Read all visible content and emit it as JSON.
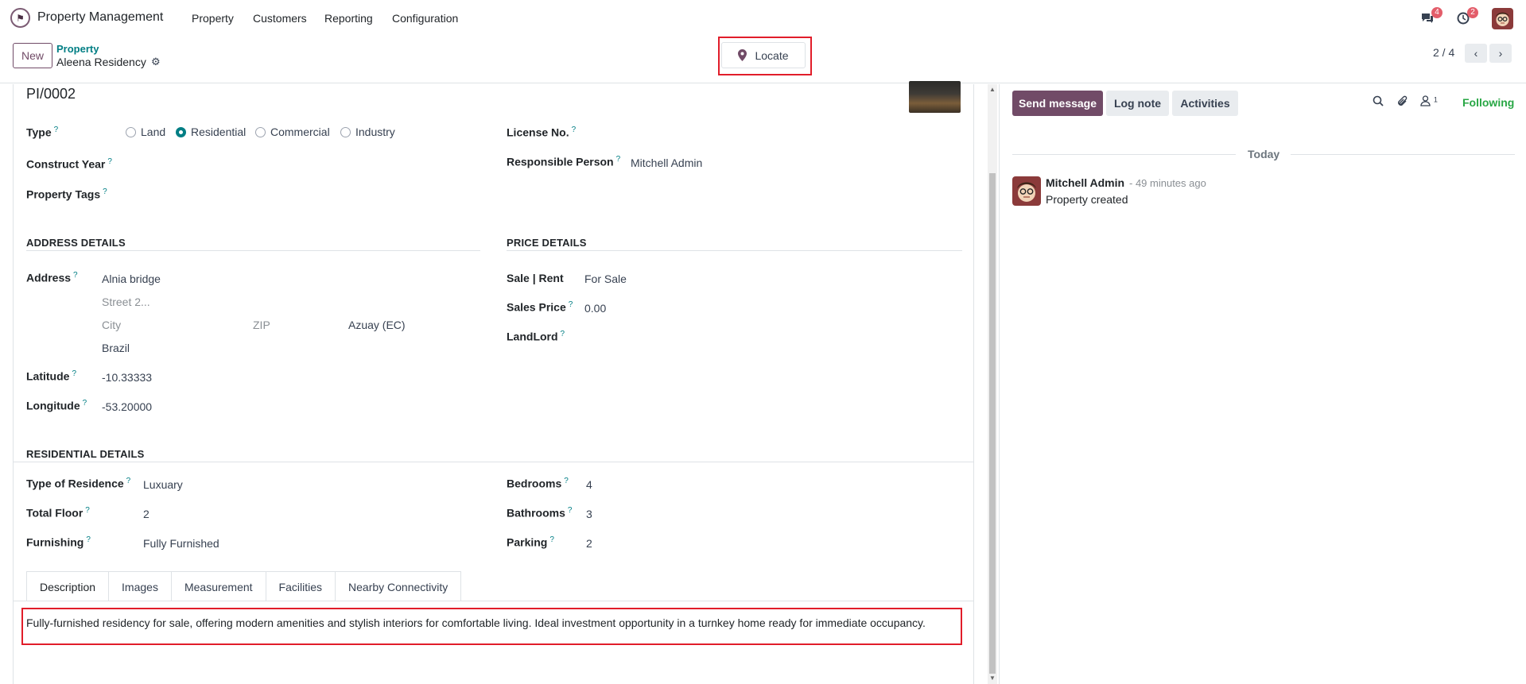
{
  "navbar": {
    "app_name": "Property Management",
    "menus": [
      "Property",
      "Customers",
      "Reporting",
      "Configuration"
    ],
    "messages_badge": "4",
    "activities_badge": "2"
  },
  "control": {
    "new_label": "New",
    "breadcrumb_parent": "Property",
    "breadcrumb_current": "Aleena Residency",
    "locate_label": "Locate",
    "pager": "2 / 4"
  },
  "form": {
    "reference": "PI/0002",
    "type_label": "Type",
    "type_options": [
      "Land",
      "Residential",
      "Commercial",
      "Industry"
    ],
    "type_selected": "Residential",
    "construct_year_label": "Construct Year",
    "property_tags_label": "Property Tags",
    "license_label": "License No.",
    "responsible_label": "Responsible Person",
    "responsible_value": "Mitchell Admin",
    "address_section": "ADDRESS DETAILS",
    "price_section": "PRICE DETAILS",
    "address_label": "Address",
    "street": "Alnia bridge",
    "street2_placeholder": "Street 2...",
    "city_placeholder": "City",
    "zip_placeholder": "ZIP",
    "state": "Azuay (EC)",
    "country": "Brazil",
    "latitude_label": "Latitude",
    "latitude": "-10.33333",
    "longitude_label": "Longitude",
    "longitude": "-53.20000",
    "sale_rent_label": "Sale | Rent",
    "sale_rent": "For Sale",
    "sales_price_label": "Sales Price",
    "sales_price": "0.00",
    "landlord_label": "LandLord",
    "residential_section": "RESIDENTIAL DETAILS",
    "residence_type_label": "Type of Residence",
    "residence_type": "Luxuary",
    "total_floor_label": "Total Floor",
    "total_floor": "2",
    "furnishing_label": "Furnishing",
    "furnishing": "Fully Furnished",
    "bedrooms_label": "Bedrooms",
    "bedrooms": "4",
    "bathrooms_label": "Bathrooms",
    "bathrooms": "3",
    "parking_label": "Parking",
    "parking": "2",
    "tabs": [
      "Description",
      "Images",
      "Measurement",
      "Facilities",
      "Nearby Connectivity"
    ],
    "description": "Fully-furnished residency for sale, offering modern amenities and stylish interiors for comfortable living. Ideal investment opportunity in a turnkey home ready for immediate occupancy."
  },
  "chatter": {
    "send_message": "Send message",
    "log_note": "Log note",
    "activities": "Activities",
    "followers_count": "1",
    "following": "Following",
    "today": "Today",
    "author": "Mitchell Admin",
    "time": "- 49 minutes ago",
    "body": "Property created"
  },
  "colors": {
    "brand": "#714b67",
    "accent": "#017e84",
    "highlight": "#e11d2a",
    "following": "#28a745"
  }
}
